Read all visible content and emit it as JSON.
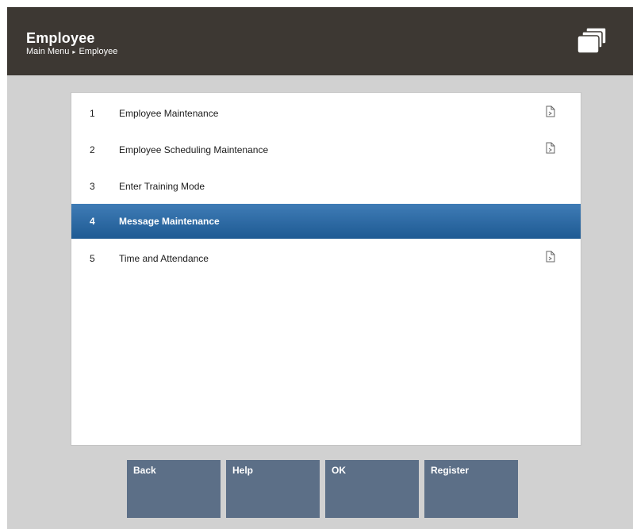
{
  "header": {
    "title": "Employee",
    "breadcrumb": [
      "Main Menu",
      "Employee"
    ],
    "breadcrumb_separator": "▸"
  },
  "menu": {
    "items": [
      {
        "number": "1",
        "label": "Employee Maintenance",
        "has_submenu": true,
        "selected": false
      },
      {
        "number": "2",
        "label": "Employee Scheduling Maintenance",
        "has_submenu": true,
        "selected": false
      },
      {
        "number": "3",
        "label": "Enter Training Mode",
        "has_submenu": false,
        "selected": false
      },
      {
        "number": "4",
        "label": "Message Maintenance",
        "has_submenu": false,
        "selected": true
      },
      {
        "number": "5",
        "label": "Time and Attendance",
        "has_submenu": true,
        "selected": false
      }
    ]
  },
  "buttons": {
    "back": "Back",
    "help": "Help",
    "ok": "OK",
    "register": "Register"
  },
  "icons": {
    "window": "window-stack-icon",
    "submenu": "submenu-document-icon"
  },
  "colors": {
    "header_bg": "#3d3833",
    "selected_row": "#2a6aa6",
    "button_bg": "#5c6f87",
    "background": "#d1d1d1"
  }
}
